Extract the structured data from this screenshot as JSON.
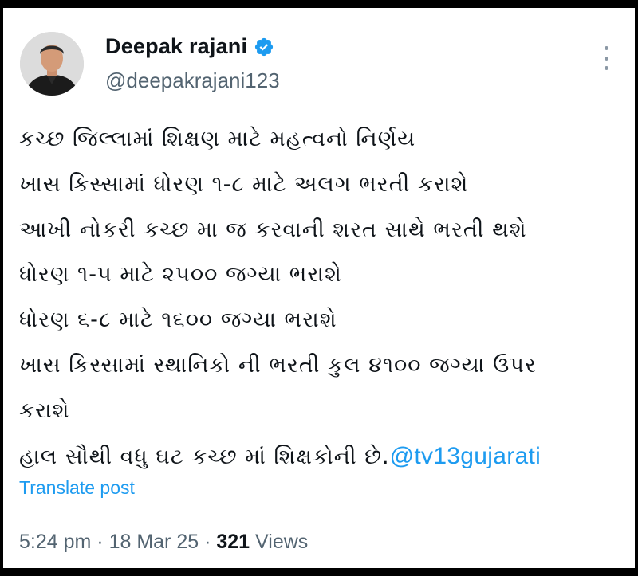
{
  "author": {
    "name": "Deepak rajani",
    "handle": "@deepakrajani123",
    "verified": true
  },
  "icons": {
    "verified": "verified-badge-icon",
    "more": "more-options-icon",
    "avatar": "profile-photo"
  },
  "colors": {
    "link": "#1d9bf0",
    "text": "#0f1419",
    "muted": "#536471",
    "verified": "#1d9bf0"
  },
  "tweet": {
    "lines": [
      "કચ્છ જિલ્લામાં શિક્ષણ માટે મહત્વનો નિર્ણય",
      "ખાસ કિસ્સામાં ધોરણ ૧-૮ માટે અલગ ભરતી કરાશે",
      "આખી નોકરી કચ્છ મા જ કરવાની શરત સાથે ભરતી થશે",
      "ધોરણ ૧-૫ માટે ૨૫૦૦ જગ્યા ભરાશે",
      "ધોરણ ૬-૮ માટે ૧૬૦૦ જગ્યા ભરાશે",
      "ખાસ કિસ્સામાં સ્થાનિકો ની ભરતી કુલ ૪૧૦૦ જગ્યા ઉપર",
      "કરાશે"
    ],
    "last_line_text": "હાલ સૌથી વધુ ઘટ કચ્છ માં શિક્ષકોની છે.",
    "mention": "@tv13gujarati"
  },
  "translate_label": "Translate post",
  "meta": {
    "time": "5:24 pm",
    "separator": "·",
    "date": "18 Mar 25",
    "views_count": "321",
    "views_label": "Views"
  }
}
